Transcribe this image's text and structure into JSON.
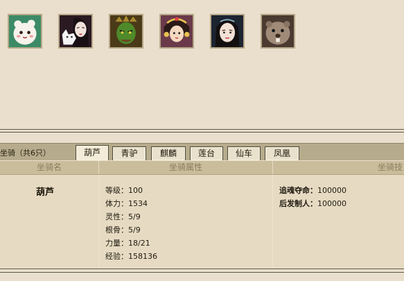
{
  "avatars": [
    {
      "name": "white-mascot-avatar"
    },
    {
      "name": "lady-with-fox-avatar"
    },
    {
      "name": "green-warrior-avatar"
    },
    {
      "name": "princess-headdress-avatar"
    },
    {
      "name": "maiden-avatar"
    },
    {
      "name": "beaver-avatar"
    }
  ],
  "panel": {
    "count_label": "坐骑（共6只）",
    "tabs": [
      "葫芦",
      "青驴",
      "麒麟",
      "莲台",
      "仙车",
      "凤凰"
    ],
    "active_tab": 0,
    "headers": {
      "name": "坐骑名",
      "attributes": "坐骑属性",
      "skills": "坐骑技"
    },
    "mount": {
      "name": "葫芦",
      "attributes": [
        "等级：100",
        "体力：1534",
        "灵性：5/9",
        "根骨：5/9",
        "力量：18/21",
        "经验：158136"
      ],
      "skills": [
        {
          "name": "追魂夺命：",
          "value": "100000"
        },
        {
          "name": "后发制人：",
          "value": "100000"
        }
      ]
    }
  }
}
